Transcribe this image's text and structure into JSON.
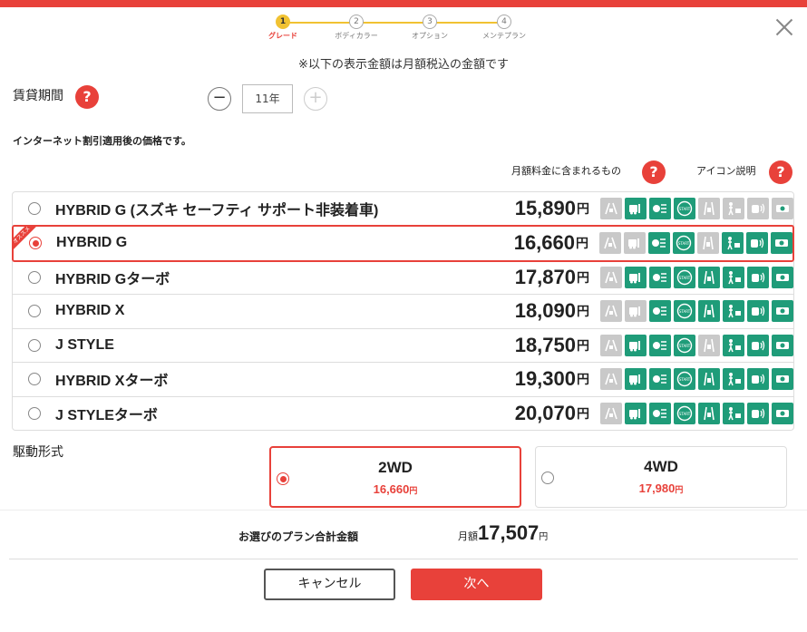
{
  "steps": [
    {
      "num": "1",
      "label": "グレード"
    },
    {
      "num": "2",
      "label": "ボディカラー"
    },
    {
      "num": "3",
      "label": "オプション"
    },
    {
      "num": "4",
      "label": "メンテプラン"
    }
  ],
  "tax_note": "※以下の表示金額は月額税込の金額です",
  "term": {
    "label": "賃貸期間",
    "value": "11年",
    "minus": "−",
    "plus": "+"
  },
  "help_mark": "?",
  "discount_note": "インターネット割引適用後の価格です。",
  "included_label": "月額料金に含まれるもの",
  "icon_explain_label": "アイコン説明",
  "recommend_badge": "オススメ",
  "feature_icons": [
    "lane-warning-icon",
    "collision-brake-icon",
    "auto-high-beam-icon",
    "push-start-icon",
    "lane-assist-icon",
    "pedestrian-detect-icon",
    "parking-sensor-icon",
    "cruise-icon"
  ],
  "grades": [
    {
      "name": "HYBRID G (スズキ セーフティ サポート非装着車)",
      "price": "15,890",
      "yen": "円",
      "selected": false,
      "features": [
        0,
        1,
        1,
        1,
        0,
        0,
        0,
        0
      ]
    },
    {
      "name": "HYBRID G",
      "price": "16,660",
      "yen": "円",
      "selected": true,
      "recommend": true,
      "features": [
        0,
        0,
        1,
        1,
        0,
        1,
        1,
        1
      ]
    },
    {
      "name": "HYBRID Gターボ",
      "price": "17,870",
      "yen": "円",
      "selected": false,
      "features": [
        0,
        1,
        1,
        1,
        1,
        1,
        1,
        1
      ]
    },
    {
      "name": "HYBRID X",
      "price": "18,090",
      "yen": "円",
      "selected": false,
      "features": [
        0,
        0,
        1,
        1,
        1,
        1,
        1,
        1
      ]
    },
    {
      "name": "J STYLE",
      "price": "18,750",
      "yen": "円",
      "selected": false,
      "features": [
        0,
        1,
        1,
        1,
        0,
        1,
        1,
        1
      ]
    },
    {
      "name": "HYBRID Xターボ",
      "price": "19,300",
      "yen": "円",
      "selected": false,
      "features": [
        0,
        1,
        1,
        1,
        1,
        1,
        1,
        1
      ]
    },
    {
      "name": "J STYLEターボ",
      "price": "20,070",
      "yen": "円",
      "selected": false,
      "features": [
        0,
        1,
        1,
        1,
        1,
        1,
        1,
        1
      ]
    }
  ],
  "drive": {
    "label": "駆動形式",
    "options": [
      {
        "name": "2WD",
        "price": "16,660",
        "yen": "円",
        "selected": true
      },
      {
        "name": "4WD",
        "price": "17,980",
        "yen": "円",
        "selected": false
      }
    ]
  },
  "total": {
    "label": "お選びのプラン合計金額",
    "prefix": "月額",
    "value": "17,507",
    "suffix": "円"
  },
  "buttons": {
    "cancel": "キャンセル",
    "next": "次へ"
  },
  "colors": {
    "accent": "#e8413a",
    "step_active": "#f1c232",
    "feature_green": "#1f9c79",
    "feature_gray": "#c9c9c9"
  }
}
